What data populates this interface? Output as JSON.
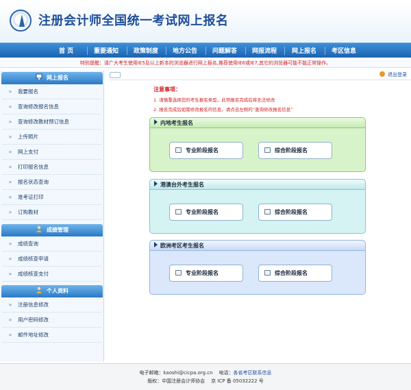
{
  "header": {
    "title": "注册会计师全国统一考试网上报名"
  },
  "nav": {
    "items": [
      "首 页",
      "重要通知",
      "政策制度",
      "地方公告",
      "问题解答",
      "网报流程",
      "网上报名",
      "考区信息"
    ]
  },
  "notice": "特别提醒：请广大考生使用IE5及以上新本的浏览器进行网上报名,推荐使用IE6或IE7,其它的浏览器可能不能正常操作。",
  "sidebar": {
    "sections": [
      {
        "title": "网上报名",
        "items": [
          "我要报名",
          "查询修改报名信息",
          "查询修改教材预订信息",
          "上传照片",
          "网上支付",
          "打印报名信息",
          "报名状态查询",
          "准考证打印",
          "订购教材"
        ]
      },
      {
        "title": "成绩管理",
        "items": [
          "成绩查询",
          "成绩核查申请",
          "成绩核查支付"
        ]
      },
      {
        "title": "个人资料",
        "items": [
          "注册信息修改",
          "用户密码修改",
          "邮件地址修改"
        ]
      }
    ]
  },
  "main": {
    "logout": "退出登录",
    "attention_title": "注意事项：",
    "attention": [
      "1. 请慎重选择您的考生报名类型，此项报名完成后将无法修改",
      "2. 报名完成后如需修改报名的信息，请点击左侧的“查询修改报名信息”"
    ],
    "panels": [
      {
        "title": "内地考生报名",
        "buttons": [
          "专业阶段报名",
          "综合阶段报名"
        ]
      },
      {
        "title": "港澳台外考生报名",
        "buttons": [
          "专业阶段报名",
          "综合阶段报名"
        ]
      },
      {
        "title": "欧洲考区考生报名",
        "buttons": [
          "专业阶段报名",
          "综合阶段报名"
        ]
      }
    ]
  },
  "footer": {
    "email_label": "电子邮箱：",
    "email": "kaoshi@cicpa.org.cn",
    "phone_label": "电话：",
    "phone": "各省考区联系信息",
    "copyright_label": "版权：",
    "copyright": "中国注册会计师协会",
    "icp": "京 ICP 备 05032222 号"
  },
  "colors": {
    "brand_blue": "#1b63b3",
    "notice_red": "#d42020"
  }
}
